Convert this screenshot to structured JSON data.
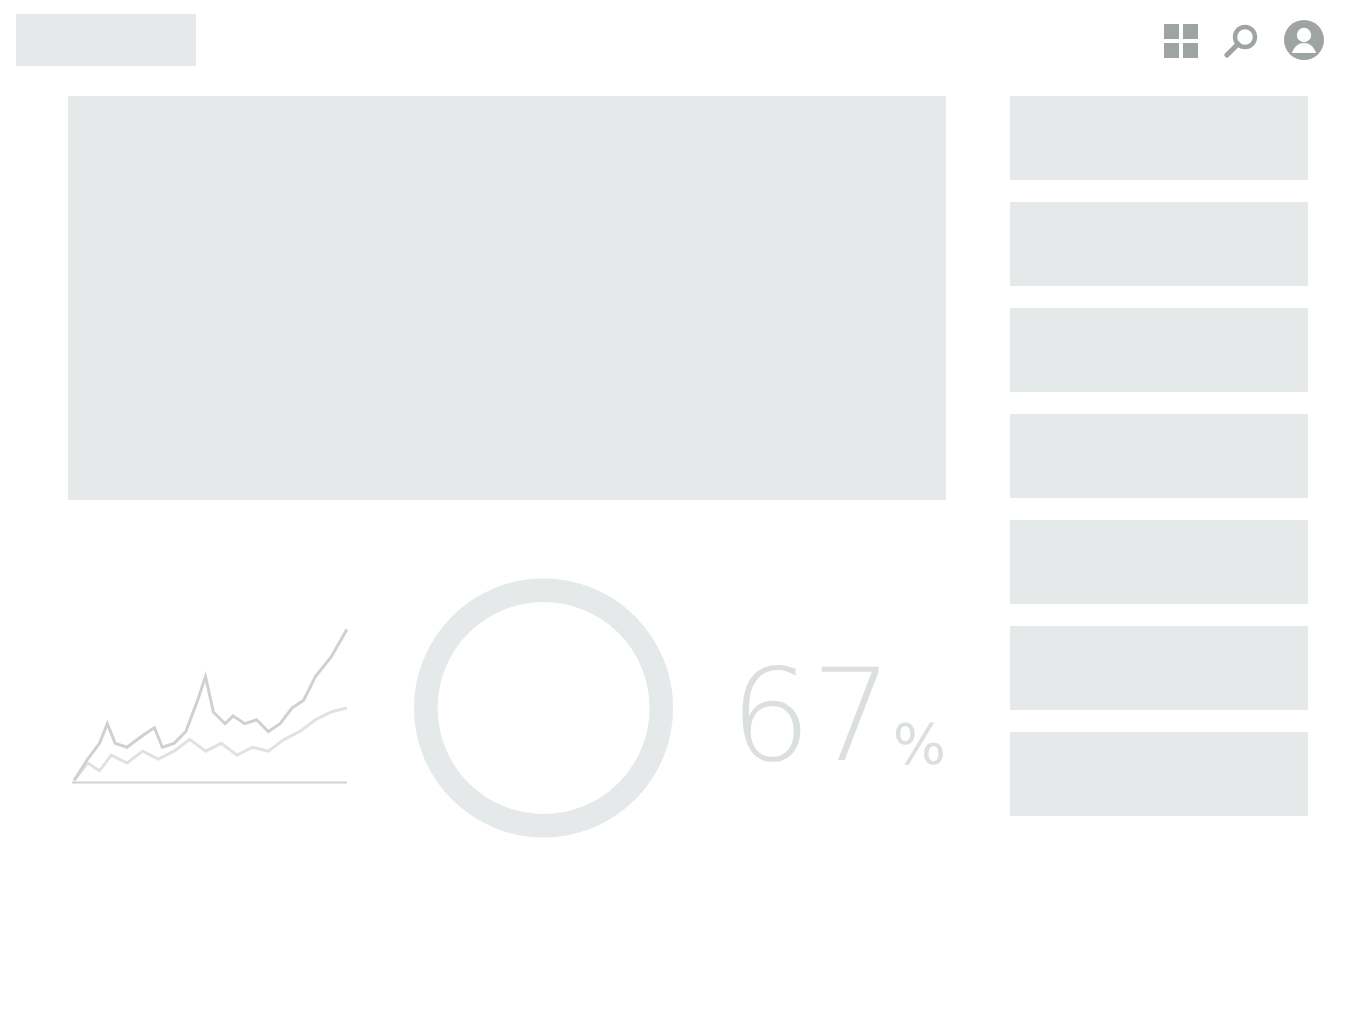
{
  "stat": {
    "value": "67",
    "unit": "%"
  }
}
